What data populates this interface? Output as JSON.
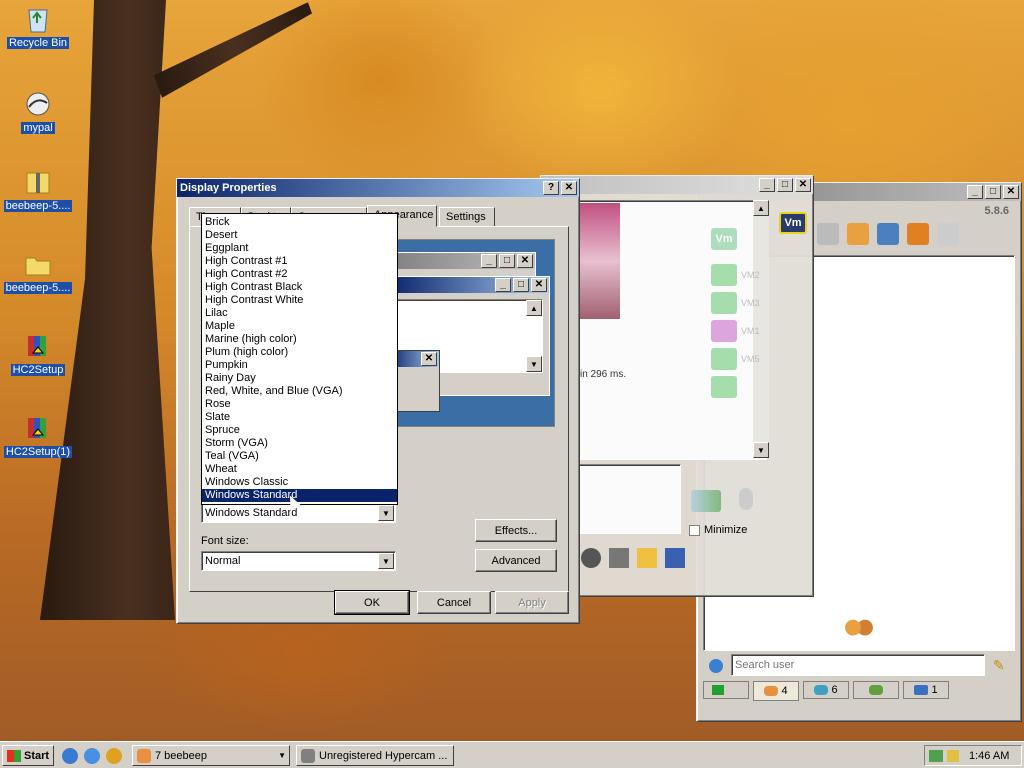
{
  "desktop": {
    "icons": [
      {
        "label": "Recycle Bin",
        "icon": "recycle-bin-icon"
      },
      {
        "label": "mypal",
        "icon": "browser-icon"
      },
      {
        "label": "beebeep-5....",
        "icon": "zip-folder-icon"
      },
      {
        "label": "beebeep-5....",
        "icon": "folder-icon"
      },
      {
        "label": "HC2Setup",
        "icon": "installer-icon"
      },
      {
        "label": "HC2Setup(1)",
        "icon": "installer-icon"
      }
    ]
  },
  "display_properties": {
    "title": "Display Properties",
    "tabs": [
      "Themes",
      "Desktop",
      "Screen Saver",
      "Appearance",
      "Settings"
    ],
    "preview_window_buttons": [
      "_",
      "□",
      "✕"
    ],
    "scheme_list": [
      "Brick",
      "Desert",
      "Eggplant",
      "High Contrast #1",
      "High Contrast #2",
      "High Contrast Black",
      "High Contrast White",
      "Lilac",
      "Maple",
      "Marine (high color)",
      "Plum (high color)",
      "Pumpkin",
      "Rainy Day",
      "Red, White, and Blue (VGA)",
      "Rose",
      "Slate",
      "Spruce",
      "Storm (VGA)",
      "Teal (VGA)",
      "Wheat",
      "Windows Classic",
      "Windows Standard"
    ],
    "selected_scheme": "Windows Standard",
    "scheme_value": "Windows Standard",
    "font_size_label": "Font size:",
    "font_size_value": "Normal",
    "effects_label": "Effects...",
    "advanced_label": "Advanced",
    "ok_label": "OK",
    "cancel_label": "Cancel",
    "apply_label": "Apply"
  },
  "chat_window": {
    "status_text": "in 296 ms.",
    "minimize_label": "Minimize",
    "vm_label": "Vm",
    "vm_items": [
      "VM2",
      "VM3",
      "VM1",
      "VM5",
      ""
    ]
  },
  "beebeep": {
    "version": "5.8.6",
    "search_placeholder": "Search user",
    "bottom_tabs": [
      "",
      "4",
      "6",
      "",
      "1"
    ]
  },
  "taskbar": {
    "start_label": "Start",
    "tasks": [
      "7 beebeep",
      "Unregistered Hypercam ..."
    ],
    "clock": "1:46 AM"
  }
}
